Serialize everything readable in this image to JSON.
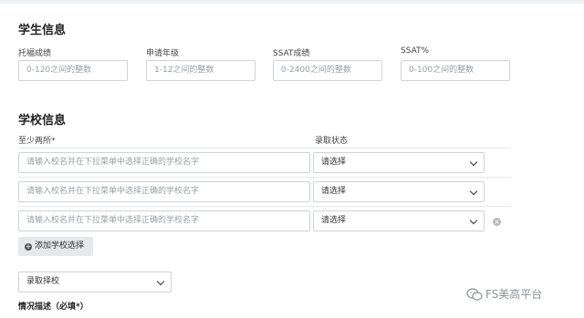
{
  "student_info": {
    "title": "学生信息",
    "fields": [
      {
        "label": "托福成绩",
        "placeholder": "0-120之间的整数"
      },
      {
        "label": "申请年级",
        "placeholder": "1-12之间的整数"
      },
      {
        "label": "SSAT成绩",
        "placeholder": "0-2400之间的整数"
      },
      {
        "label": "SSAT%",
        "placeholder": "0-100之间的整数"
      }
    ]
  },
  "school_info": {
    "title": "学校信息",
    "school_col_label": "至少两所*",
    "status_col_label": "录取状态",
    "rows": [
      {
        "placeholder": "请输入校名并在下拉菜单中选择正确的学校名字",
        "status": "请选择"
      },
      {
        "placeholder": "请输入校名并在下拉菜单中选择正确的学校名字",
        "status": "请选择"
      },
      {
        "placeholder": "请输入校名并在下拉菜单中选择正确的学校名字",
        "status": "请选择"
      }
    ],
    "remove_glyph": "×",
    "add_button_label": "添加学校选择",
    "add_icon_glyph": "+",
    "final_choice": "录取择校",
    "description_label": "情况描述（必填*）"
  },
  "watermark": {
    "text": "FS美高平台",
    "icon": "wechat-icon"
  }
}
